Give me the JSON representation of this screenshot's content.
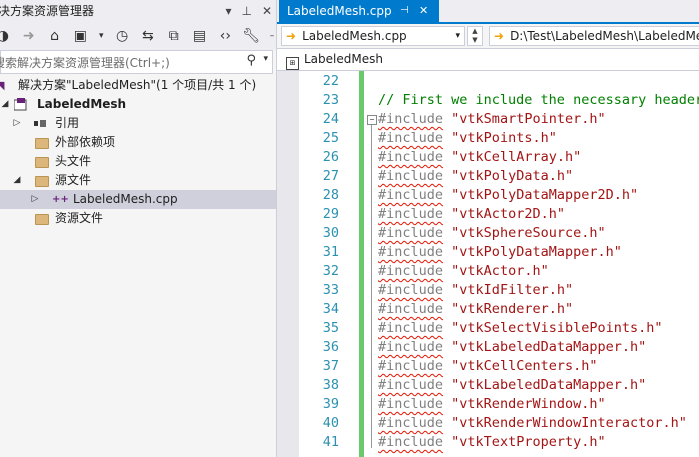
{
  "solution_explorer": {
    "title": "决方案资源管理器",
    "search_placeholder": "搜索解决方案资源管理器(Ctrl+;)",
    "tree": {
      "solution": "解决方案\"LabeledMesh\"(1 个项目/共 1 个)",
      "project": "LabeledMesh",
      "references": "引用",
      "external_deps": "外部依赖项",
      "headers": "头文件",
      "sources": "源文件",
      "cpp_file": "LabeledMesh.cpp",
      "resources": "资源文件"
    }
  },
  "editor": {
    "tab_label": "LabeledMesh.cpp",
    "nav_file": "LabeledMesh.cpp",
    "nav_path": "D:\\Test\\LabeledMesh\\LabeledMesh",
    "breadcrumb": "LabeledMesh",
    "lines": [
      {
        "num": "22",
        "code": "",
        "type": "blank"
      },
      {
        "num": "23",
        "code": "// First we include the necessary header",
        "type": "comment"
      },
      {
        "num": "24",
        "kw": "#include",
        "str": "\"vtkSmartPointer.h\"",
        "type": "include"
      },
      {
        "num": "25",
        "kw": "#include",
        "str": "\"vtkPoints.h\"",
        "type": "include"
      },
      {
        "num": "26",
        "kw": "#include",
        "str": "\"vtkCellArray.h\"",
        "type": "include"
      },
      {
        "num": "27",
        "kw": "#include",
        "str": "\"vtkPolyData.h\"",
        "type": "include"
      },
      {
        "num": "28",
        "kw": "#include",
        "str": "\"vtkPolyDataMapper2D.h\"",
        "type": "include"
      },
      {
        "num": "29",
        "kw": "#include",
        "str": "\"vtkActor2D.h\"",
        "type": "include"
      },
      {
        "num": "30",
        "kw": "#include",
        "str": "\"vtkSphereSource.h\"",
        "type": "include"
      },
      {
        "num": "31",
        "kw": "#include",
        "str": "\"vtkPolyDataMapper.h\"",
        "type": "include"
      },
      {
        "num": "32",
        "kw": "#include",
        "str": "\"vtkActor.h\"",
        "type": "include"
      },
      {
        "num": "33",
        "kw": "#include",
        "str": "\"vtkIdFilter.h\"",
        "type": "include"
      },
      {
        "num": "34",
        "kw": "#include",
        "str": "\"vtkRenderer.h\"",
        "type": "include"
      },
      {
        "num": "35",
        "kw": "#include",
        "str": "\"vtkSelectVisiblePoints.h\"",
        "type": "include"
      },
      {
        "num": "36",
        "kw": "#include",
        "str": "\"vtkLabeledDataMapper.h\"",
        "type": "include"
      },
      {
        "num": "37",
        "kw": "#include",
        "str": "\"vtkCellCenters.h\"",
        "type": "include"
      },
      {
        "num": "38",
        "kw": "#include",
        "str": "\"vtkLabeledDataMapper.h\"",
        "type": "include"
      },
      {
        "num": "39",
        "kw": "#include",
        "str": "\"vtkRenderWindow.h\"",
        "type": "include"
      },
      {
        "num": "40",
        "kw": "#include",
        "str": "\"vtkRenderWindowInteractor.h\"",
        "type": "include"
      },
      {
        "num": "41",
        "kw": "#include",
        "str": "\"vtkTextProperty.h\"",
        "type": "include"
      }
    ]
  }
}
